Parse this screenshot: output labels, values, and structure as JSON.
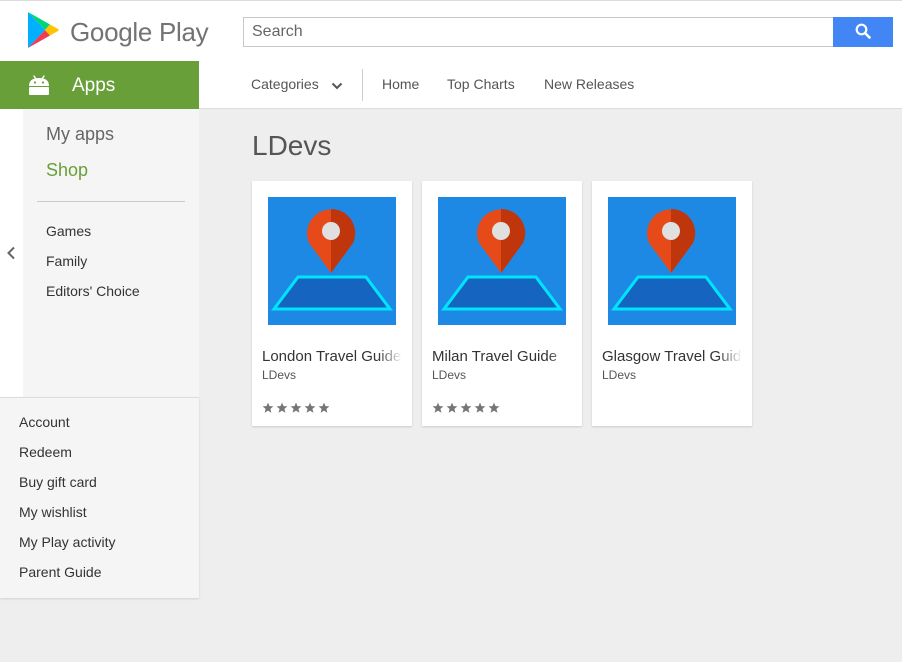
{
  "header": {
    "brand": "Google Play",
    "search_placeholder": "Search"
  },
  "apps_tab": {
    "label": "Apps"
  },
  "nav": {
    "categories": "Categories",
    "home": "Home",
    "top_charts": "Top Charts",
    "new_releases": "New Releases"
  },
  "sidebar": {
    "my_apps": "My apps",
    "shop": "Shop",
    "links": [
      "Games",
      "Family",
      "Editors' Choice"
    ]
  },
  "account_menu": [
    "Account",
    "Redeem",
    "Buy gift card",
    "My wishlist",
    "My Play activity",
    "Parent Guide"
  ],
  "page": {
    "title": "LDevs"
  },
  "apps": [
    {
      "title": "London Travel Guide",
      "developer": "LDevs",
      "rating_stars": 5
    },
    {
      "title": "Milan Travel Guide",
      "developer": "LDevs",
      "rating_stars": 5
    },
    {
      "title": "Glasgow Travel Guide",
      "developer": "LDevs",
      "rating_stars": 0
    }
  ],
  "colors": {
    "apps_green": "#689f38",
    "shop_green": "#689f38",
    "search_blue": "#4285f4",
    "icon_blue": "#1e88e5"
  }
}
